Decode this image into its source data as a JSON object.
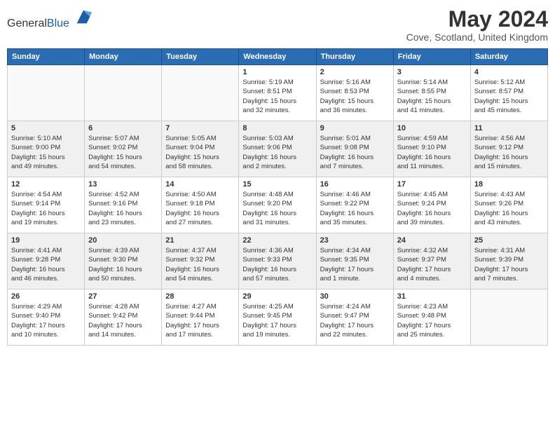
{
  "header": {
    "logo_general": "General",
    "logo_blue": "Blue",
    "main_title": "May 2024",
    "subtitle": "Cove, Scotland, United Kingdom"
  },
  "days_of_week": [
    "Sunday",
    "Monday",
    "Tuesday",
    "Wednesday",
    "Thursday",
    "Friday",
    "Saturday"
  ],
  "weeks": [
    [
      {
        "day": "",
        "info": ""
      },
      {
        "day": "",
        "info": ""
      },
      {
        "day": "",
        "info": ""
      },
      {
        "day": "1",
        "info": "Sunrise: 5:19 AM\nSunset: 8:51 PM\nDaylight: 15 hours\nand 32 minutes."
      },
      {
        "day": "2",
        "info": "Sunrise: 5:16 AM\nSunset: 8:53 PM\nDaylight: 15 hours\nand 36 minutes."
      },
      {
        "day": "3",
        "info": "Sunrise: 5:14 AM\nSunset: 8:55 PM\nDaylight: 15 hours\nand 41 minutes."
      },
      {
        "day": "4",
        "info": "Sunrise: 5:12 AM\nSunset: 8:57 PM\nDaylight: 15 hours\nand 45 minutes."
      }
    ],
    [
      {
        "day": "5",
        "info": "Sunrise: 5:10 AM\nSunset: 9:00 PM\nDaylight: 15 hours\nand 49 minutes."
      },
      {
        "day": "6",
        "info": "Sunrise: 5:07 AM\nSunset: 9:02 PM\nDaylight: 15 hours\nand 54 minutes."
      },
      {
        "day": "7",
        "info": "Sunrise: 5:05 AM\nSunset: 9:04 PM\nDaylight: 15 hours\nand 58 minutes."
      },
      {
        "day": "8",
        "info": "Sunrise: 5:03 AM\nSunset: 9:06 PM\nDaylight: 16 hours\nand 2 minutes."
      },
      {
        "day": "9",
        "info": "Sunrise: 5:01 AM\nSunset: 9:08 PM\nDaylight: 16 hours\nand 7 minutes."
      },
      {
        "day": "10",
        "info": "Sunrise: 4:59 AM\nSunset: 9:10 PM\nDaylight: 16 hours\nand 11 minutes."
      },
      {
        "day": "11",
        "info": "Sunrise: 4:56 AM\nSunset: 9:12 PM\nDaylight: 16 hours\nand 15 minutes."
      }
    ],
    [
      {
        "day": "12",
        "info": "Sunrise: 4:54 AM\nSunset: 9:14 PM\nDaylight: 16 hours\nand 19 minutes."
      },
      {
        "day": "13",
        "info": "Sunrise: 4:52 AM\nSunset: 9:16 PM\nDaylight: 16 hours\nand 23 minutes."
      },
      {
        "day": "14",
        "info": "Sunrise: 4:50 AM\nSunset: 9:18 PM\nDaylight: 16 hours\nand 27 minutes."
      },
      {
        "day": "15",
        "info": "Sunrise: 4:48 AM\nSunset: 9:20 PM\nDaylight: 16 hours\nand 31 minutes."
      },
      {
        "day": "16",
        "info": "Sunrise: 4:46 AM\nSunset: 9:22 PM\nDaylight: 16 hours\nand 35 minutes."
      },
      {
        "day": "17",
        "info": "Sunrise: 4:45 AM\nSunset: 9:24 PM\nDaylight: 16 hours\nand 39 minutes."
      },
      {
        "day": "18",
        "info": "Sunrise: 4:43 AM\nSunset: 9:26 PM\nDaylight: 16 hours\nand 43 minutes."
      }
    ],
    [
      {
        "day": "19",
        "info": "Sunrise: 4:41 AM\nSunset: 9:28 PM\nDaylight: 16 hours\nand 46 minutes."
      },
      {
        "day": "20",
        "info": "Sunrise: 4:39 AM\nSunset: 9:30 PM\nDaylight: 16 hours\nand 50 minutes."
      },
      {
        "day": "21",
        "info": "Sunrise: 4:37 AM\nSunset: 9:32 PM\nDaylight: 16 hours\nand 54 minutes."
      },
      {
        "day": "22",
        "info": "Sunrise: 4:36 AM\nSunset: 9:33 PM\nDaylight: 16 hours\nand 57 minutes."
      },
      {
        "day": "23",
        "info": "Sunrise: 4:34 AM\nSunset: 9:35 PM\nDaylight: 17 hours\nand 1 minute."
      },
      {
        "day": "24",
        "info": "Sunrise: 4:32 AM\nSunset: 9:37 PM\nDaylight: 17 hours\nand 4 minutes."
      },
      {
        "day": "25",
        "info": "Sunrise: 4:31 AM\nSunset: 9:39 PM\nDaylight: 17 hours\nand 7 minutes."
      }
    ],
    [
      {
        "day": "26",
        "info": "Sunrise: 4:29 AM\nSunset: 9:40 PM\nDaylight: 17 hours\nand 10 minutes."
      },
      {
        "day": "27",
        "info": "Sunrise: 4:28 AM\nSunset: 9:42 PM\nDaylight: 17 hours\nand 14 minutes."
      },
      {
        "day": "28",
        "info": "Sunrise: 4:27 AM\nSunset: 9:44 PM\nDaylight: 17 hours\nand 17 minutes."
      },
      {
        "day": "29",
        "info": "Sunrise: 4:25 AM\nSunset: 9:45 PM\nDaylight: 17 hours\nand 19 minutes."
      },
      {
        "day": "30",
        "info": "Sunrise: 4:24 AM\nSunset: 9:47 PM\nDaylight: 17 hours\nand 22 minutes."
      },
      {
        "day": "31",
        "info": "Sunrise: 4:23 AM\nSunset: 9:48 PM\nDaylight: 17 hours\nand 25 minutes."
      },
      {
        "day": "",
        "info": ""
      }
    ]
  ]
}
